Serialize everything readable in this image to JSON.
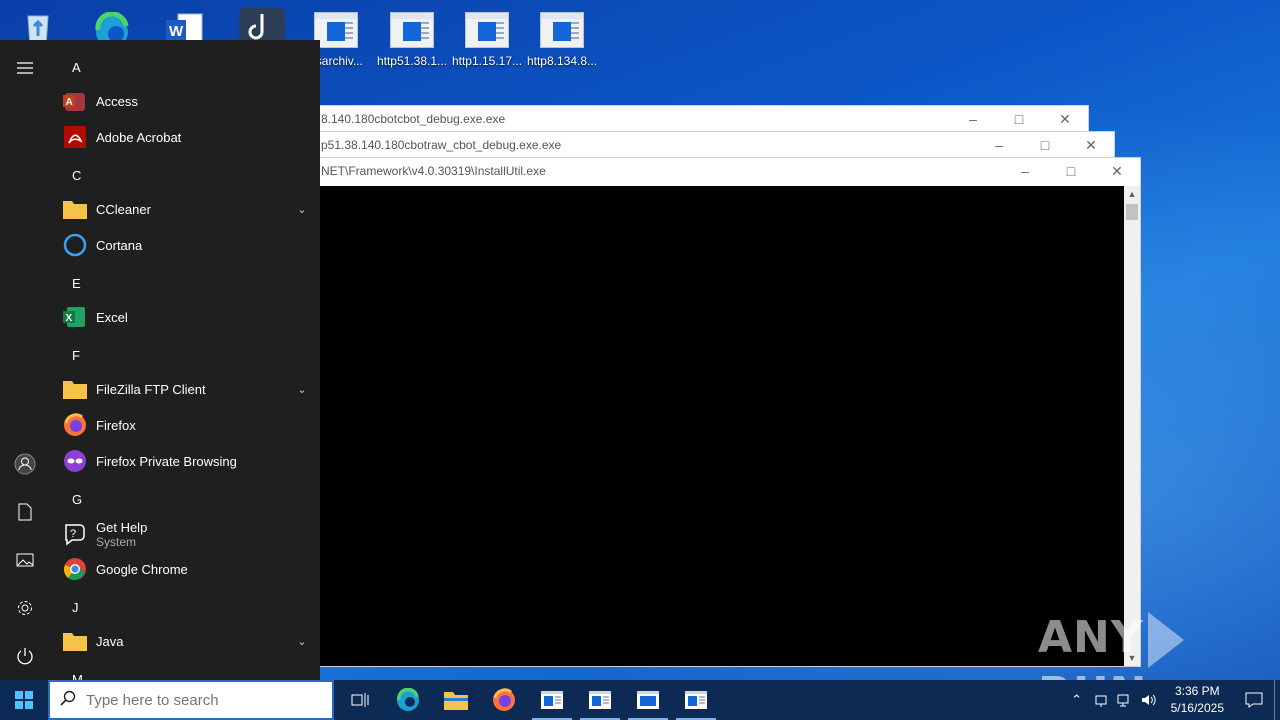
{
  "desktop": {
    "icons": [
      {
        "name": "recycle-bin",
        "label": ""
      },
      {
        "name": "edge",
        "label": ""
      },
      {
        "name": "word",
        "label": ""
      },
      {
        "name": "app",
        "label": ""
      },
      {
        "name": "exe1",
        "label": "osarchiv..."
      },
      {
        "name": "exe2",
        "label": "http51.38.1..."
      },
      {
        "name": "exe3",
        "label": "http1.15.17..."
      },
      {
        "name": "exe4",
        "label": "http8.134.8..."
      }
    ]
  },
  "windows": [
    {
      "title": "8.140.180cbotcbot_debug.exe.exe"
    },
    {
      "title": "p51.38.140.180cbotraw_cbot_debug.exe.exe"
    },
    {
      "title": "NET\\Framework\\v4.0.30319\\InstallUtil.exe"
    }
  ],
  "watermark": {
    "left": "ANY",
    "right": "RUN"
  },
  "start_menu": {
    "sections": [
      {
        "letter": "A"
      },
      {
        "letter": "C"
      },
      {
        "letter": "E"
      },
      {
        "letter": "F"
      },
      {
        "letter": "G"
      },
      {
        "letter": "J"
      },
      {
        "letter": "M"
      }
    ],
    "apps": [
      {
        "name": "Access"
      },
      {
        "name": "Adobe Acrobat"
      },
      {
        "name": "CCleaner"
      },
      {
        "name": "Cortana"
      },
      {
        "name": "Excel"
      },
      {
        "name": "FileZilla FTP Client"
      },
      {
        "name": "Firefox"
      },
      {
        "name": "Firefox Private Browsing"
      },
      {
        "name": "Get Help",
        "sub": "System"
      },
      {
        "name": "Google Chrome"
      },
      {
        "name": "Java"
      }
    ]
  },
  "taskbar": {
    "search_placeholder": "Type here to search",
    "time": "3:36 PM",
    "date": "5/16/2025"
  },
  "colors": {
    "accent": "#0d2a55",
    "start_bg": "#1f1f1f",
    "desktop": "#0c57c8"
  }
}
